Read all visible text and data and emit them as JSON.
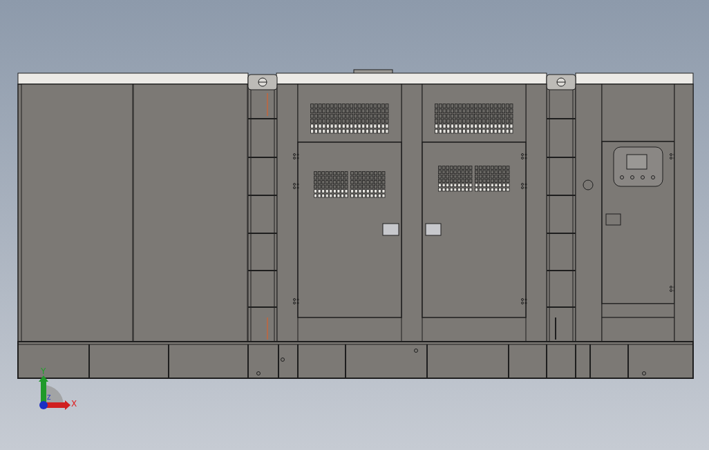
{
  "viewport": {
    "axes": [
      {
        "kind": "x",
        "label": "X"
      },
      {
        "kind": "y",
        "label": "Y"
      },
      {
        "kind": "z",
        "label": "Z"
      }
    ]
  }
}
